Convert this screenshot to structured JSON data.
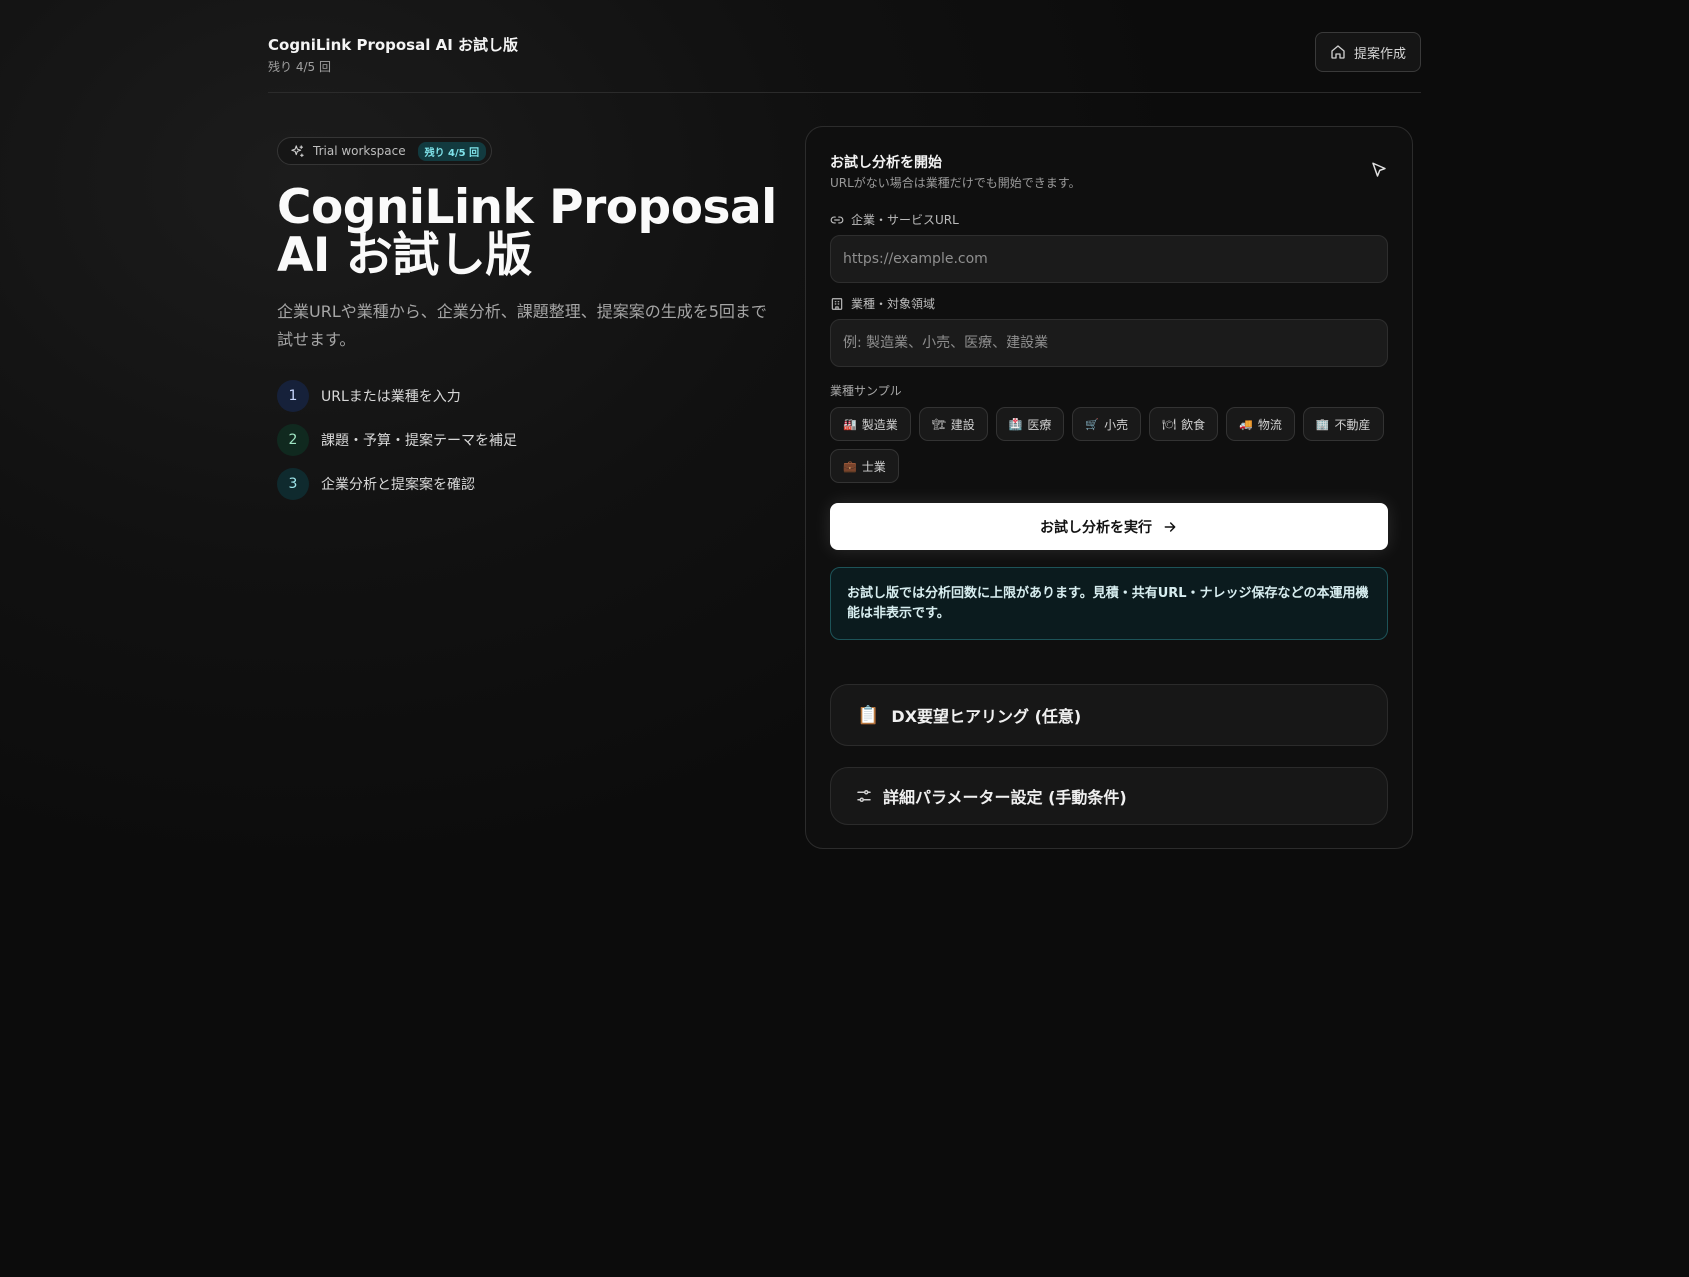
{
  "header": {
    "title": "CogniLink Proposal AI お試し版",
    "remaining": "残り 4/5 回",
    "proposal_button": "提案作成",
    "proposal_icon": "home-icon"
  },
  "hero": {
    "badge_label": "Trial workspace",
    "badge_pill": "残り 4/5 回",
    "title_line1": "CogniLink Proposal",
    "title_line2": "AI お試し版",
    "description": "企業URLや業種から、企業分析、課題整理、提案案の生成を5回まで試せます。",
    "steps": [
      {
        "num": "1",
        "label": "URLまたは業種を入力"
      },
      {
        "num": "2",
        "label": "課題・予算・提案テーマを補足"
      },
      {
        "num": "3",
        "label": "企業分析と提案案を確認"
      }
    ]
  },
  "form": {
    "title": "お試し分析を開始",
    "subtitle": "URLがない場合は業種だけでも開始できます。",
    "url_label": "企業・サービスURL",
    "url_placeholder": "https://example.com",
    "url_value": "",
    "industry_label": "業種・対象領域",
    "industry_placeholder": "例: 製造業、小売、医療、建設業",
    "industry_value": "",
    "samples_label": "業種サンプル",
    "samples": [
      {
        "emoji": "🏭",
        "label": "製造業"
      },
      {
        "emoji": "🏗",
        "label": "建設"
      },
      {
        "emoji": "🏥",
        "label": "医療"
      },
      {
        "emoji": "🛒",
        "label": "小売"
      },
      {
        "emoji": "🍽",
        "label": "飲食"
      },
      {
        "emoji": "🚚",
        "label": "物流"
      },
      {
        "emoji": "🏢",
        "label": "不動産"
      },
      {
        "emoji": "💼",
        "label": "士業"
      }
    ],
    "run_button": "お試し分析を実行",
    "notice": "お試し版では分析回数に上限があります。見積・共有URL・ナレッジ保存などの本運用機能は非表示です。",
    "accordion_hearing": "DX要望ヒアリング (任意)",
    "accordion_hearing_icon": "📋",
    "accordion_params": "詳細パラメーター設定 (手動条件)"
  },
  "colors": {
    "background": "#111111",
    "accent_teal": "#7fe3ea",
    "notice_border": "#1d5358"
  }
}
